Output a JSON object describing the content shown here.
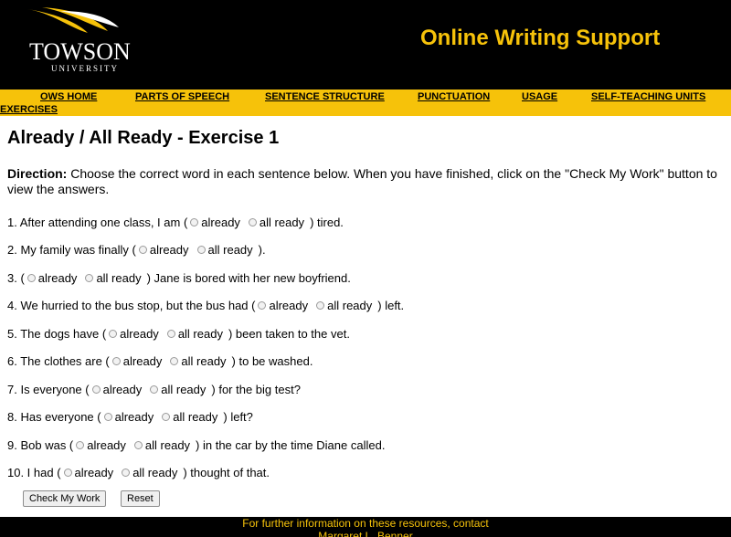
{
  "header": {
    "logo_name": "TOWSON",
    "logo_sub": "UNIVERSITY",
    "site_title": "Online Writing Support"
  },
  "nav": {
    "items": [
      "OWS HOME",
      "PARTS OF SPEECH",
      "SENTENCE STRUCTURE",
      "PUNCTUATION",
      "USAGE",
      "SELF-TEACHING UNITS",
      "EXERCISES"
    ]
  },
  "page_title": "Already / All Ready - Exercise 1",
  "direction": {
    "label": "Direction:",
    "text": " Choose the correct word in each sentence below. When you have finished, click on the \"Check My Work\" button to view the answers."
  },
  "options": [
    "already",
    "all ready"
  ],
  "questions": [
    {
      "before": "1. After attending one class, I am (",
      "after": ") tired."
    },
    {
      "before": "2. My family was finally (",
      "after": ")."
    },
    {
      "before": "3. (",
      "after": ") Jane is bored with her new boyfriend."
    },
    {
      "before": "4. We hurried to the bus stop, but the bus had (",
      "after": ") left."
    },
    {
      "before": "5. The dogs have (",
      "after": ") been taken to the vet."
    },
    {
      "before": "6. The clothes are (",
      "after": ") to be washed."
    },
    {
      "before": "7. Is everyone (",
      "after": ") for the big test?"
    },
    {
      "before": "8. Has everyone (",
      "after": ") left?"
    },
    {
      "before": "9. Bob was (",
      "after": ") in the car by the time Diane called."
    },
    {
      "before": "10. I had (",
      "after": ") thought of that."
    }
  ],
  "buttons": {
    "check": "Check My Work",
    "reset": "Reset"
  },
  "footer": {
    "line1": "For further information on these resources, contact",
    "line2": "Margaret L. Benner"
  },
  "colors": {
    "header_bg": "#000000",
    "accent_gold": "#f6c20a"
  }
}
